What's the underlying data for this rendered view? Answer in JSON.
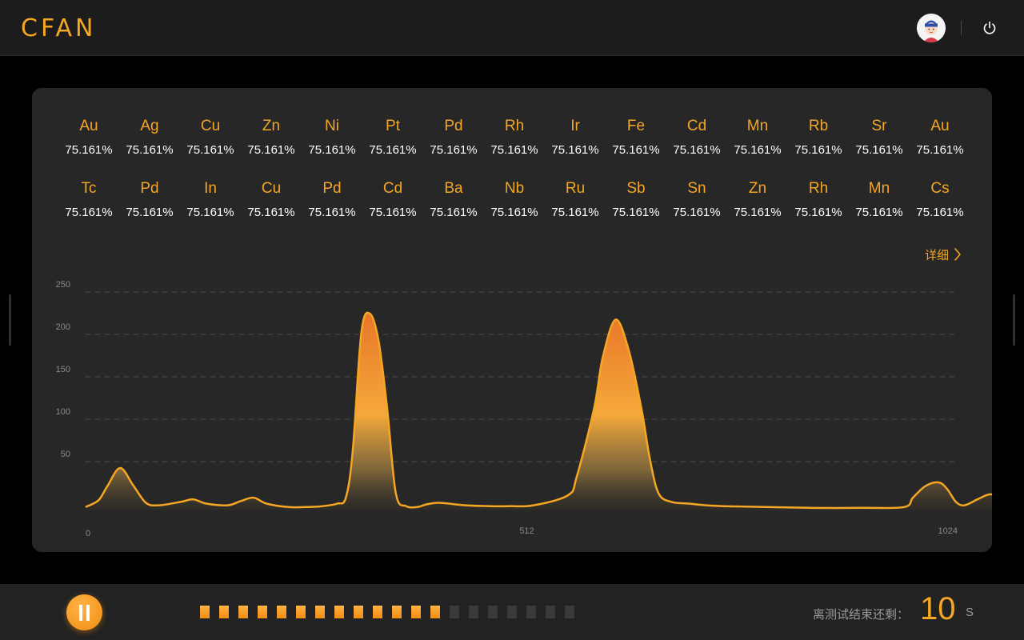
{
  "header": {
    "logo_text": "CFAN",
    "avatar_icon": "user-avatar",
    "power_icon": "power-icon"
  },
  "elements": {
    "row1": [
      {
        "symbol": "Au",
        "value": "75.161%"
      },
      {
        "symbol": "Ag",
        "value": "75.161%"
      },
      {
        "symbol": "Cu",
        "value": "75.161%"
      },
      {
        "symbol": "Zn",
        "value": "75.161%"
      },
      {
        "symbol": "Ni",
        "value": "75.161%"
      },
      {
        "symbol": "Pt",
        "value": "75.161%"
      },
      {
        "symbol": "Pd",
        "value": "75.161%"
      },
      {
        "symbol": "Rh",
        "value": "75.161%"
      },
      {
        "symbol": "Ir",
        "value": "75.161%"
      },
      {
        "symbol": "Fe",
        "value": "75.161%"
      },
      {
        "symbol": "Cd",
        "value": "75.161%"
      },
      {
        "symbol": "Mn",
        "value": "75.161%"
      },
      {
        "symbol": "Rb",
        "value": "75.161%"
      },
      {
        "symbol": "Sr",
        "value": "75.161%"
      },
      {
        "symbol": "Au",
        "value": "75.161%"
      }
    ],
    "row2": [
      {
        "symbol": "Tc",
        "value": "75.161%"
      },
      {
        "symbol": "Pd",
        "value": "75.161%"
      },
      {
        "symbol": "In",
        "value": "75.161%"
      },
      {
        "symbol": "Cu",
        "value": "75.161%"
      },
      {
        "symbol": "Pd",
        "value": "75.161%"
      },
      {
        "symbol": "Cd",
        "value": "75.161%"
      },
      {
        "symbol": "Ba",
        "value": "75.161%"
      },
      {
        "symbol": "Nb",
        "value": "75.161%"
      },
      {
        "symbol": "Ru",
        "value": "75.161%"
      },
      {
        "symbol": "Sb",
        "value": "75.161%"
      },
      {
        "symbol": "Sn",
        "value": "75.161%"
      },
      {
        "symbol": "Zn",
        "value": "75.161%"
      },
      {
        "symbol": "Rh",
        "value": "75.161%"
      },
      {
        "symbol": "Mn",
        "value": "75.161%"
      },
      {
        "symbol": "Cs",
        "value": "75.161%"
      }
    ]
  },
  "detail_link": {
    "label": "详细",
    "icon": "chevron-right-icon"
  },
  "chart_data": {
    "type": "area",
    "ylim": [
      0,
      250
    ],
    "y_ticks": [
      50,
      100,
      150,
      200,
      250
    ],
    "x_ticks": [
      0,
      512,
      1024
    ],
    "xlim": [
      0,
      1024
    ],
    "grid": true,
    "color": "#f5a623",
    "x": [
      0,
      15,
      25,
      40,
      55,
      70,
      85,
      110,
      125,
      140,
      165,
      180,
      195,
      210,
      235,
      255,
      275,
      292,
      302,
      310,
      320,
      330,
      340,
      350,
      360,
      372,
      385,
      395,
      410,
      440,
      470,
      490,
      520,
      560,
      570,
      590,
      600,
      615,
      630,
      645,
      655,
      665,
      680,
      700,
      720,
      740,
      790,
      840,
      900,
      950,
      960,
      975,
      990,
      1000,
      1010,
      1020,
      1035,
      1050,
      1065,
      1080,
      1095,
      1103
    ],
    "y": [
      4,
      12,
      28,
      50,
      30,
      9,
      6,
      10,
      13,
      8,
      6,
      11,
      15,
      8,
      4,
      4,
      5,
      8,
      15,
      70,
      210,
      232,
      200,
      120,
      20,
      5,
      4,
      7,
      9,
      6,
      5,
      5,
      6,
      18,
      40,
      120,
      180,
      225,
      190,
      120,
      60,
      20,
      10,
      8,
      6,
      5,
      4,
      3,
      3,
      4,
      15,
      29,
      33,
      25,
      10,
      6,
      13,
      19,
      14,
      5,
      3,
      2
    ]
  },
  "bottom": {
    "pause_icon": "pause-icon",
    "progress": {
      "filled": 13,
      "total": 20
    },
    "timer_label": "离测试结束还剩：",
    "timer_value": "10",
    "timer_unit": "S"
  }
}
